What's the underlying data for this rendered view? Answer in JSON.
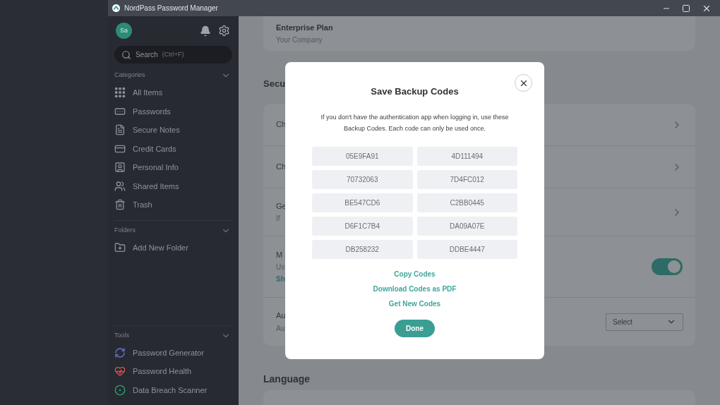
{
  "window": {
    "title": "NordPass Password Manager"
  },
  "sidebar": {
    "avatar": "Sa",
    "search": {
      "label": "Search",
      "shortcut": "(Ctrl+F)"
    },
    "sections": [
      {
        "title": "Categories",
        "items": [
          {
            "label": "All Items",
            "kind": "grid"
          },
          {
            "label": "Passwords",
            "kind": "password"
          },
          {
            "label": "Secure Notes",
            "kind": "note"
          },
          {
            "label": "Credit Cards",
            "kind": "card"
          },
          {
            "label": "Personal Info",
            "kind": "person"
          },
          {
            "label": "Shared Items",
            "kind": "shared"
          },
          {
            "label": "Trash",
            "kind": "trash"
          }
        ]
      },
      {
        "title": "Folders",
        "items": [
          {
            "label": "Add New Folder",
            "kind": "folder"
          }
        ]
      }
    ],
    "tools": {
      "title": "Tools",
      "items": [
        {
          "label": "Password Generator",
          "kind": "generator"
        },
        {
          "label": "Password Health",
          "kind": "health"
        },
        {
          "label": "Data Breach Scanner",
          "kind": "scanner"
        }
      ]
    }
  },
  "main": {
    "plan": {
      "title": "Enterprise Plan",
      "subtitle": "Your Company"
    },
    "security": {
      "heading": "Secu",
      "rows": [
        {
          "kind": "link",
          "title": "Ch"
        },
        {
          "kind": "link",
          "title": "Ch"
        },
        {
          "kind": "link",
          "title": "Ge",
          "subtitle": "If"
        },
        {
          "kind": "toggle",
          "title": "M",
          "subtitle": "Us",
          "link": "Sh",
          "on": true
        },
        {
          "kind": "select",
          "title": "Au",
          "subtitle": "Au",
          "value": "Select"
        }
      ]
    },
    "language": {
      "heading": "Language"
    }
  },
  "modal": {
    "title": "Save Backup Codes",
    "description": "If you don't have the authentication app when logging in, use these Backup Codes. Each code can only be used once.",
    "codes": [
      "05E9FA91",
      "4D111494",
      "70732063",
      "7D4FC012",
      "BE547CD6",
      "C2BB0445",
      "D6F1C7B4",
      "DA09A07E",
      "DB258232",
      "DDBE4447"
    ],
    "links": [
      "Copy Codes",
      "Download Codes as PDF",
      "Get New Codes"
    ],
    "done": "Done"
  }
}
